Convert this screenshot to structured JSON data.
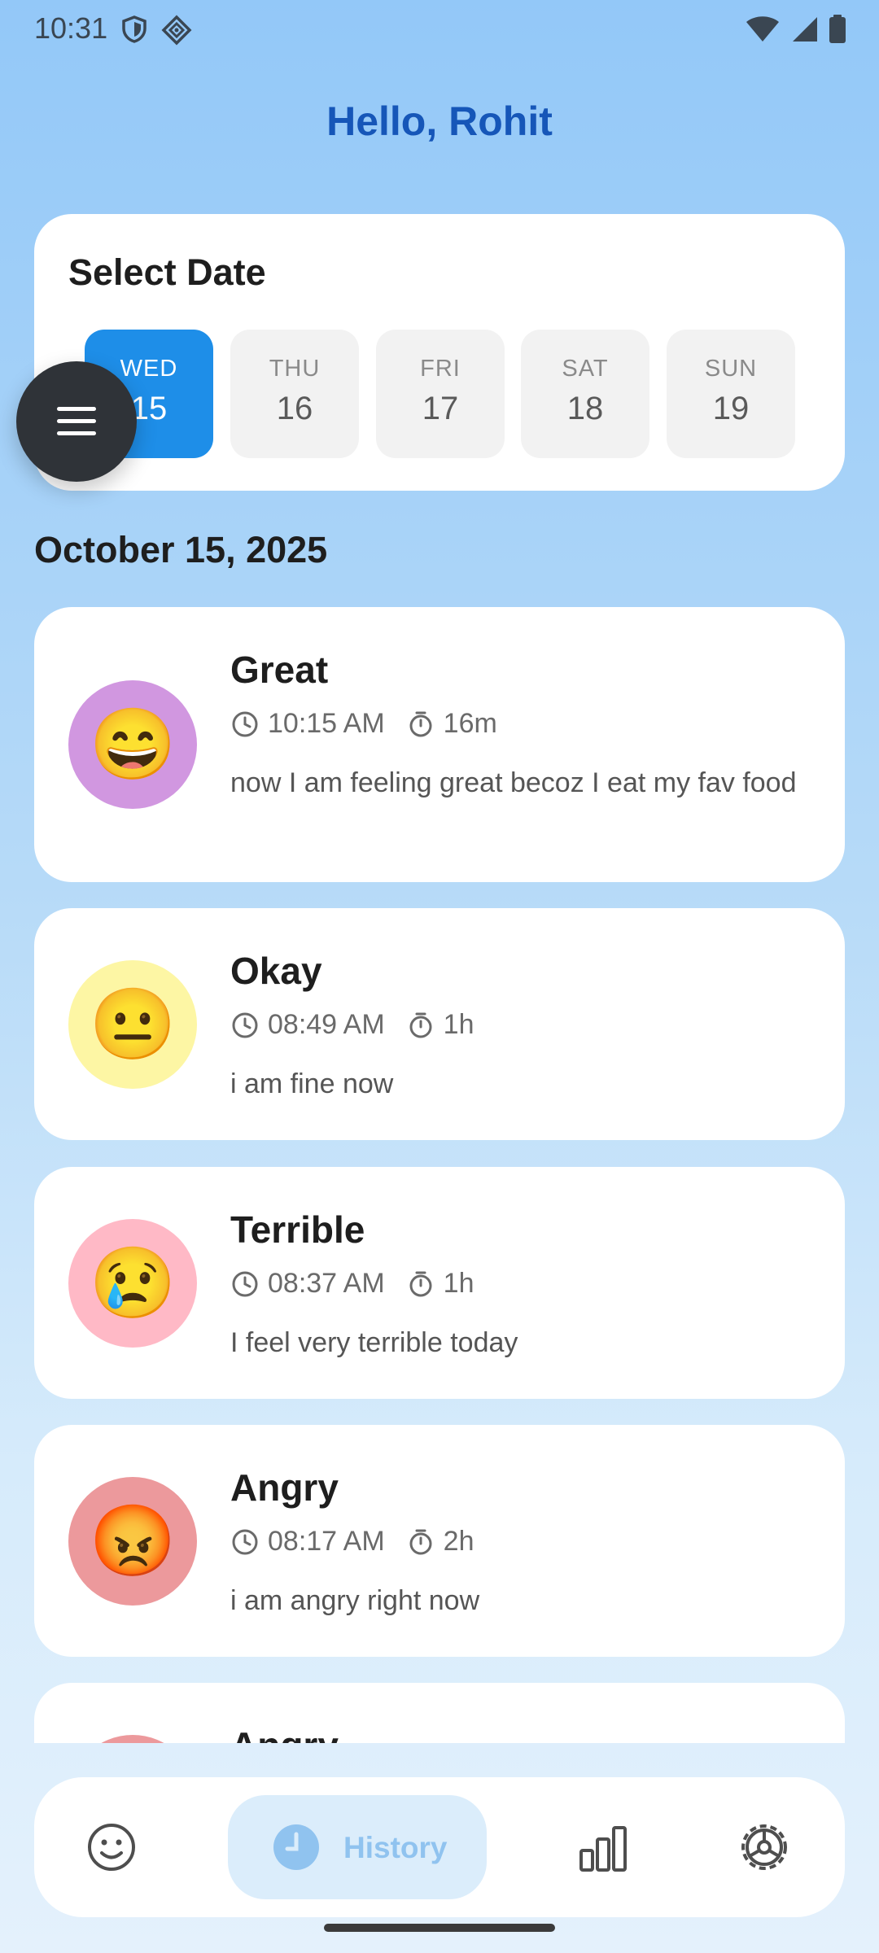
{
  "status_bar": {
    "time": "10:31"
  },
  "header": {
    "greeting": "Hello, Rohit"
  },
  "date_picker": {
    "title": "Select Date",
    "days": [
      {
        "name": "WED",
        "number": "15",
        "selected": true
      },
      {
        "name": "THU",
        "number": "16",
        "selected": false
      },
      {
        "name": "FRI",
        "number": "17",
        "selected": false
      },
      {
        "name": "SAT",
        "number": "18",
        "selected": false
      },
      {
        "name": "SUN",
        "number": "19",
        "selected": false
      }
    ]
  },
  "section": {
    "date": "October 15, 2025"
  },
  "entries": [
    {
      "mood": "Great",
      "emoji": "😄",
      "time": "10:15 AM",
      "duration": "16m",
      "note": "now I am feeling great becoz I eat my fav food",
      "color": "#d197e0"
    },
    {
      "mood": "Okay",
      "emoji": "😐",
      "time": "08:49 AM",
      "duration": "1h",
      "note": "i am fine now",
      "color": "#fdf6a4"
    },
    {
      "mood": "Terrible",
      "emoji": "😢",
      "time": "08:37 AM",
      "duration": "1h",
      "note": "I feel very terrible today",
      "color": "#ffb9c6"
    },
    {
      "mood": "Angry",
      "emoji": "😡",
      "time": "08:17 AM",
      "duration": "2h",
      "note": "i am angry right now",
      "color": "#ec999c"
    },
    {
      "mood": "Angry",
      "emoji": "",
      "time": "",
      "duration": "",
      "note": "",
      "color": "#ec999c"
    }
  ],
  "nav": {
    "items": [
      {
        "icon": "smiley-icon",
        "label": ""
      },
      {
        "icon": "history-clock-icon",
        "label": "History",
        "active": true
      },
      {
        "icon": "bar-chart-icon",
        "label": ""
      },
      {
        "icon": "settings-gear-icon",
        "label": ""
      }
    ]
  },
  "colors": {
    "accent": "#1e8ee8",
    "greeting": "#1656b8",
    "nav_active_bg": "#dbedfb",
    "nav_active_fg": "#90c3ef",
    "fab": "#2f3338"
  }
}
